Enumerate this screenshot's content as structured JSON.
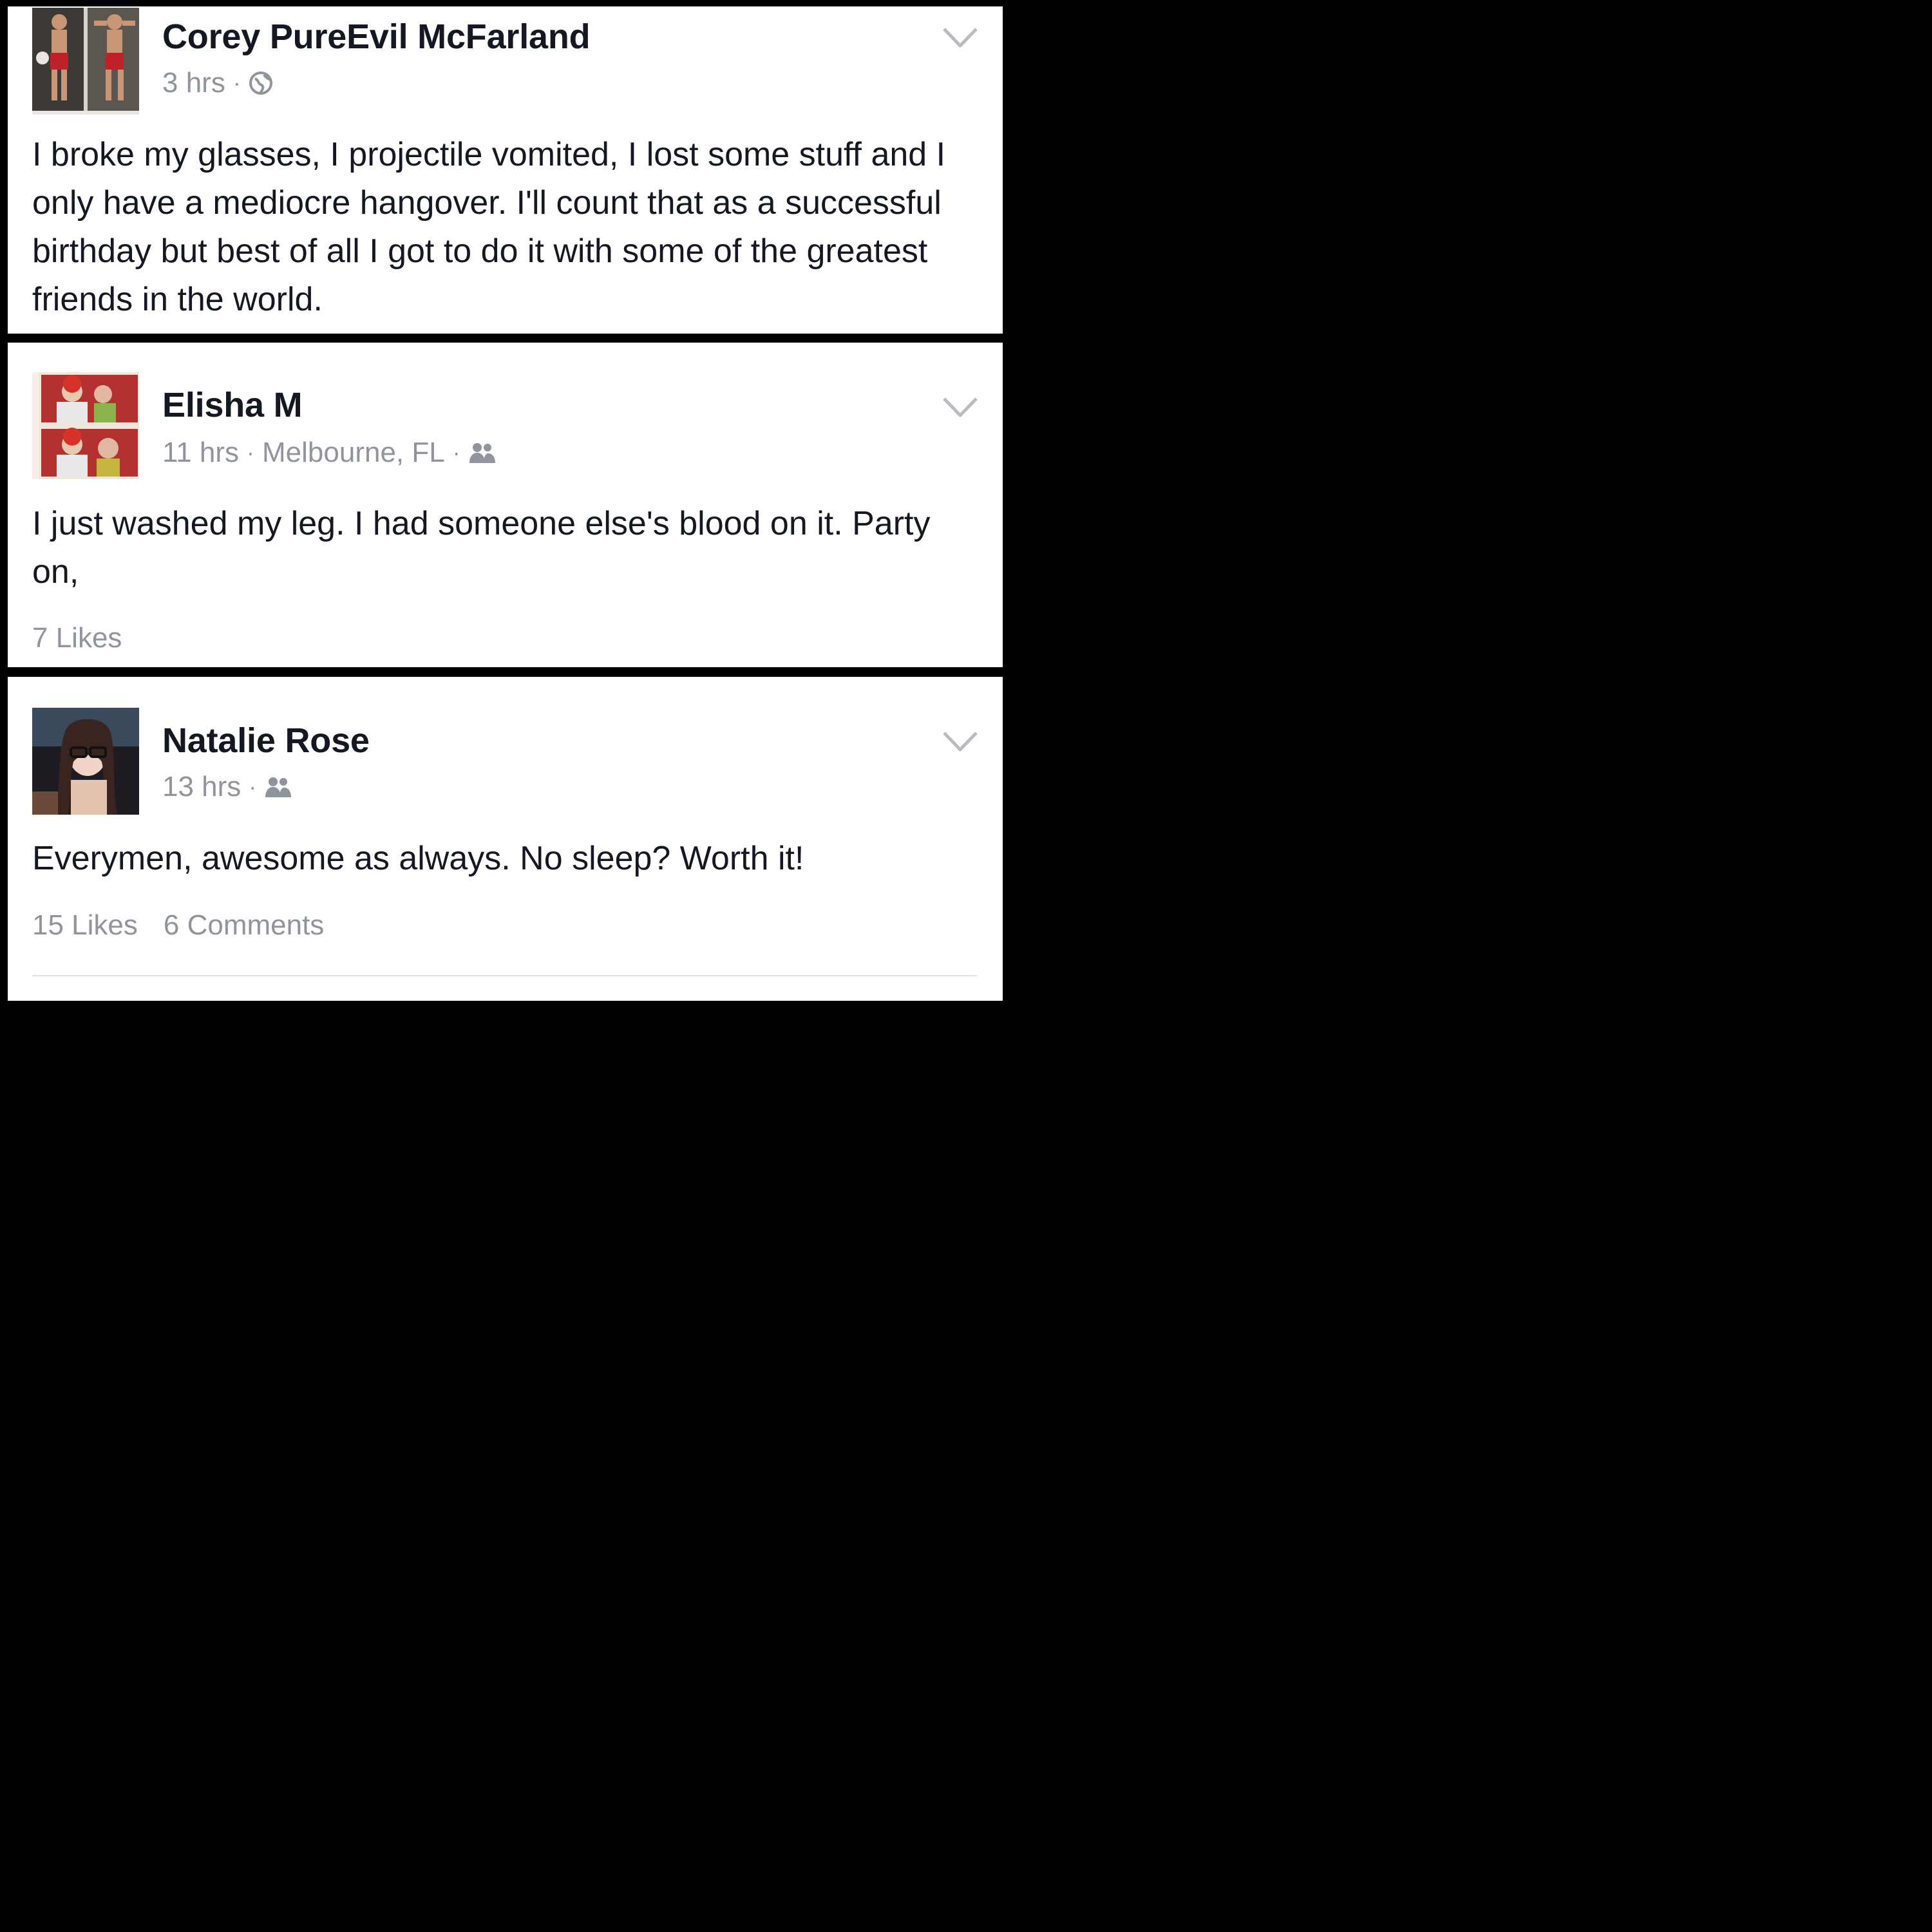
{
  "posts": [
    {
      "author": "Corey PureEvil McFarland",
      "time": "3 hrs",
      "location": "",
      "privacy_icon": "globe-icon",
      "text": "I broke my glasses, I projectile vomited, I lost some stuff and I only have a mediocre hangover. I'll count that as a successful birthday but best of all I got to do it with some of the greatest friends in the world.",
      "likes": "",
      "comments": ""
    },
    {
      "author": "Elisha M",
      "time": "11 hrs",
      "location": "Melbourne, FL",
      "privacy_icon": "friends-icon",
      "text": "I just washed my leg. I had someone else's blood on it. Party on,",
      "likes": "7 Likes",
      "comments": ""
    },
    {
      "author": "Natalie Rose",
      "time": "13 hrs",
      "location": "",
      "privacy_icon": "friends-icon",
      "text": "Everymen, awesome as always. No sleep? Worth it!",
      "likes": "15 Likes",
      "comments": "6 Comments"
    }
  ],
  "separator": "·",
  "colors": {
    "author_text": "#141823",
    "meta_text": "#90949c",
    "background": "#ffffff",
    "frame": "#000000"
  }
}
